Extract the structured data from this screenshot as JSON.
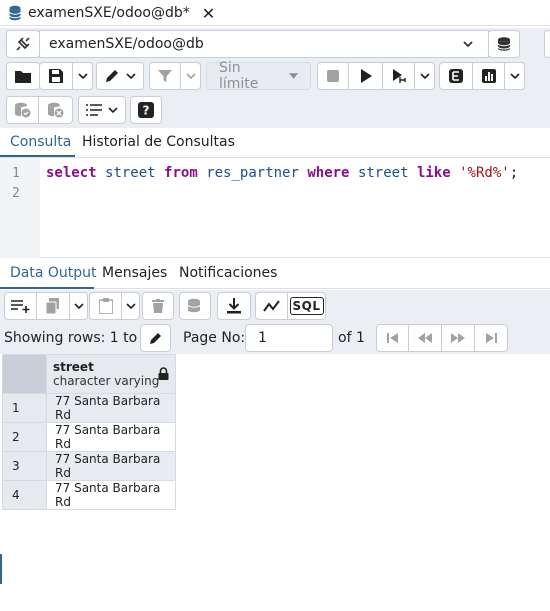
{
  "tab": {
    "title": "examenSXE/odoo@db*",
    "close_glyph": "✕"
  },
  "connection": {
    "value": "examenSXE/odoo@db"
  },
  "toolbar": {
    "limit_label": "Sin límite"
  },
  "query_tabs": [
    {
      "label": "Consulta",
      "active": true
    },
    {
      "label": "Historial de Consultas",
      "active": false
    }
  ],
  "editor": {
    "line_numbers": [
      "1",
      "2"
    ],
    "tokens": {
      "select": "select",
      "col": "street",
      "from": "from",
      "table": "res_partner",
      "where": "where",
      "col2": "street",
      "like": "like",
      "pattern": "'%Rd%'",
      "end": ";"
    }
  },
  "output_tabs": [
    {
      "label": "Data Output",
      "active": true
    },
    {
      "label": "Mensajes",
      "active": false
    },
    {
      "label": "Notificaciones",
      "active": false
    }
  ],
  "output_toolbar": {
    "sql_label": "SQL"
  },
  "pager": {
    "showing": "Showing rows: 1 to 4",
    "page_label": "Page No:",
    "page_value": "1",
    "of_label": "of 1"
  },
  "grid": {
    "column": {
      "name": "street",
      "type": "character varying"
    },
    "rows": [
      {
        "num": "1",
        "street": "77 Santa Barbara Rd"
      },
      {
        "num": "2",
        "street": "77 Santa Barbara Rd"
      },
      {
        "num": "3",
        "street": "77 Santa Barbara Rd"
      },
      {
        "num": "4",
        "street": "77 Santa Barbara Rd"
      }
    ]
  },
  "colors": {
    "accent": "#326690",
    "toolbar_bg": "#ebeef3",
    "keyword": "#8a0e8a",
    "identifier": "#1a4f8a",
    "string": "#a31515"
  },
  "icons": {
    "tab": "database-icon",
    "connection": "disconnected-plug-icon",
    "toolbar": [
      "folder-open-icon",
      "save-icon",
      "edit-pencil-icon",
      "filter-icon",
      "stop-icon",
      "play-icon",
      "explain-icon",
      "explain-analyze-icon",
      "chart-icon",
      "commit-icon",
      "rollback-icon",
      "macros-icon",
      "help-icon"
    ],
    "output": [
      "add-row-icon",
      "copy-icon",
      "paste-icon",
      "delete-icon",
      "save-data-icon",
      "download-icon",
      "graph-icon",
      "lock-icon"
    ]
  }
}
